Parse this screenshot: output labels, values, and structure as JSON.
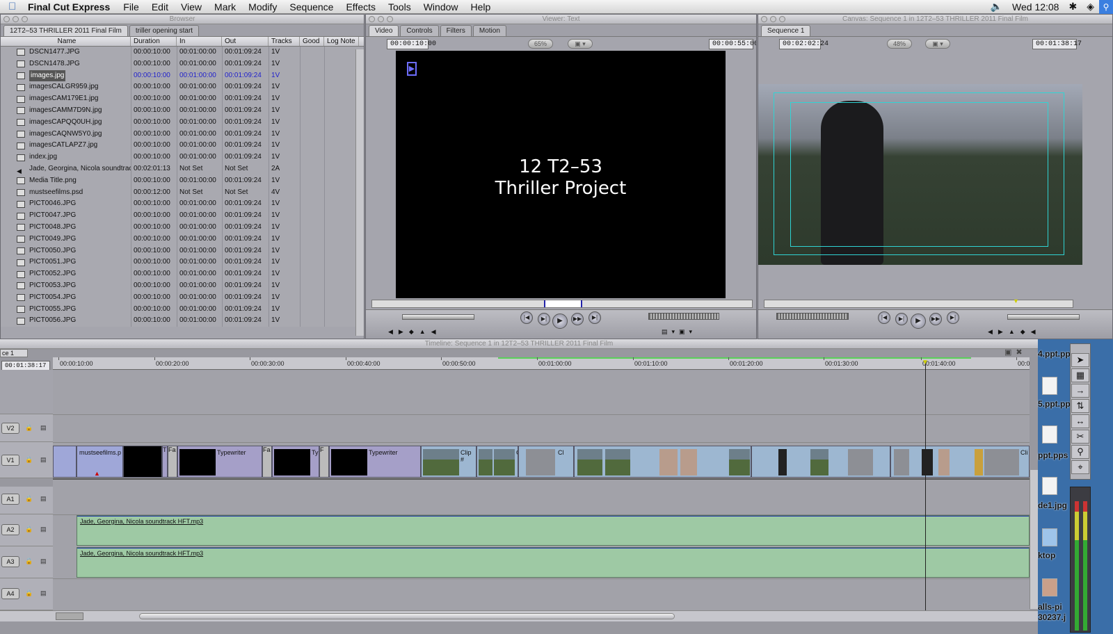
{
  "menubar": {
    "app": "Final Cut Express",
    "items": [
      "File",
      "Edit",
      "View",
      "Mark",
      "Modify",
      "Sequence",
      "Effects",
      "Tools",
      "Window",
      "Help"
    ],
    "clock": "Wed 12:08"
  },
  "browser": {
    "title": "Browser",
    "tabs": [
      "12T2–53 THRILLER 2011 Final Film",
      "triller opening start"
    ],
    "columns": [
      "Name",
      "Duration",
      "In",
      "Out",
      "Tracks",
      "Good",
      "Log Note"
    ],
    "rows": [
      {
        "name": "DSCN1477.JPG",
        "dur": "00:00:10:00",
        "in": "00:01:00:00",
        "out": "00:01:09:24",
        "tracks": "1V"
      },
      {
        "name": "DSCN1478.JPG",
        "dur": "00:00:10:00",
        "in": "00:01:00:00",
        "out": "00:01:09:24",
        "tracks": "1V"
      },
      {
        "name": "images.jpg",
        "dur": "00:00:10:00",
        "in": "00:01:00:00",
        "out": "00:01:09:24",
        "tracks": "1V"
      },
      {
        "name": "imagesCALGR959.jpg",
        "dur": "00:00:10:00",
        "in": "00:01:00:00",
        "out": "00:01:09:24",
        "tracks": "1V"
      },
      {
        "name": "imagesCAM179E1.jpg",
        "dur": "00:00:10:00",
        "in": "00:01:00:00",
        "out": "00:01:09:24",
        "tracks": "1V"
      },
      {
        "name": "imagesCAMM7D9N.jpg",
        "dur": "00:00:10:00",
        "in": "00:01:00:00",
        "out": "00:01:09:24",
        "tracks": "1V"
      },
      {
        "name": "imagesCAPQQ0UH.jpg",
        "dur": "00:00:10:00",
        "in": "00:01:00:00",
        "out": "00:01:09:24",
        "tracks": "1V"
      },
      {
        "name": "imagesCAQNW5Y0.jpg",
        "dur": "00:00:10:00",
        "in": "00:01:00:00",
        "out": "00:01:09:24",
        "tracks": "1V"
      },
      {
        "name": "imagesCATLAPZ7.jpg",
        "dur": "00:00:10:00",
        "in": "00:01:00:00",
        "out": "00:01:09:24",
        "tracks": "1V"
      },
      {
        "name": "index.jpg",
        "dur": "00:00:10:00",
        "in": "00:01:00:00",
        "out": "00:01:09:24",
        "tracks": "1V"
      },
      {
        "name": "Jade, Georgina, Nicola soundtrack H",
        "dur": "00:02:01:13",
        "in": "Not Set",
        "out": "Not Set",
        "tracks": "2A"
      },
      {
        "name": "Media Title.png",
        "dur": "00:00:10:00",
        "in": "00:01:00:00",
        "out": "00:01:09:24",
        "tracks": "1V"
      },
      {
        "name": "mustseefilms.psd",
        "dur": "00:00:12:00",
        "in": "Not Set",
        "out": "Not Set",
        "tracks": "4V"
      },
      {
        "name": "PICT0046.JPG",
        "dur": "00:00:10:00",
        "in": "00:01:00:00",
        "out": "00:01:09:24",
        "tracks": "1V"
      },
      {
        "name": "PICT0047.JPG",
        "dur": "00:00:10:00",
        "in": "00:01:00:00",
        "out": "00:01:09:24",
        "tracks": "1V"
      },
      {
        "name": "PICT0048.JPG",
        "dur": "00:00:10:00",
        "in": "00:01:00:00",
        "out": "00:01:09:24",
        "tracks": "1V"
      },
      {
        "name": "PICT0049.JPG",
        "dur": "00:00:10:00",
        "in": "00:01:00:00",
        "out": "00:01:09:24",
        "tracks": "1V"
      },
      {
        "name": "PICT0050.JPG",
        "dur": "00:00:10:00",
        "in": "00:01:00:00",
        "out": "00:01:09:24",
        "tracks": "1V"
      },
      {
        "name": "PICT0051.JPG",
        "dur": "00:00:10:00",
        "in": "00:01:00:00",
        "out": "00:01:09:24",
        "tracks": "1V"
      },
      {
        "name": "PICT0052.JPG",
        "dur": "00:00:10:00",
        "in": "00:01:00:00",
        "out": "00:01:09:24",
        "tracks": "1V"
      },
      {
        "name": "PICT0053.JPG",
        "dur": "00:00:10:00",
        "in": "00:01:00:00",
        "out": "00:01:09:24",
        "tracks": "1V"
      },
      {
        "name": "PICT0054.JPG",
        "dur": "00:00:10:00",
        "in": "00:01:00:00",
        "out": "00:01:09:24",
        "tracks": "1V"
      },
      {
        "name": "PICT0055.JPG",
        "dur": "00:00:10:00",
        "in": "00:01:00:00",
        "out": "00:01:09:24",
        "tracks": "1V"
      },
      {
        "name": "PICT0056.JPG",
        "dur": "00:00:10:00",
        "in": "00:01:00:00",
        "out": "00:01:09:24",
        "tracks": "1V"
      }
    ],
    "selected_row": 2
  },
  "viewer": {
    "title": "Viewer: Text",
    "tabs": [
      "Video",
      "Controls",
      "Filters",
      "Motion"
    ],
    "duration": "00:00:10:00",
    "zoom": "65%",
    "current": "00:00:55:00",
    "text_line1": "12 T2–53",
    "text_line2": "Thriller Project"
  },
  "canvas": {
    "title": "Canvas: Sequence 1 in 12T2–53 THRILLER 2011 Final Film",
    "tab": "Sequence 1",
    "duration": "00:02:02:24",
    "zoom": "48%",
    "current": "00:01:38:17"
  },
  "timeline": {
    "title": "Timeline: Sequence 1 in 12T2–53 THRILLER 2011 Final Film",
    "seq_tab": "ce 1",
    "current": "00:01:38:17",
    "ticks": [
      "00:00:10:00",
      "00:00:20:00",
      "00:00:30:00",
      "00:00:40:00",
      "00:00:50:00",
      "00:01:00:00",
      "00:01:10:00",
      "00:01:20:00",
      "00:01:30:00",
      "00:01:40:00",
      "00:0"
    ],
    "tracks": [
      "V2",
      "V1",
      "A1",
      "A2",
      "A3",
      "A4"
    ],
    "v1_clips": {
      "mustsee": "mustseefilms.p",
      "tf": "T",
      "fa": "Fa",
      "typewriter1": "Typewriter",
      "fa2": "Fa",
      "ty": "Ty",
      "f": "F",
      "typewriter2": "Typewriter",
      "clip": "Clip #",
      "c": "C",
      "cl": "Cl",
      "cl2": "Cli"
    },
    "audio_clip": "Jade, Georgina, Nicola soundtrack HFT.mp3"
  },
  "desktop": {
    "items": [
      "4.ppt.pp",
      "5.ppt.pp",
      "ppt.pps",
      "de1.jpg",
      "ktop",
      "alls-pi",
      "30237.j"
    ]
  }
}
